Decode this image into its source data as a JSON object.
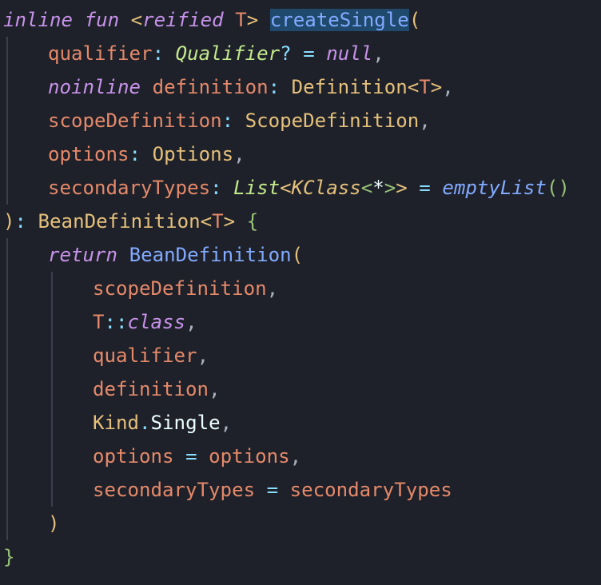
{
  "editor": {
    "lines": {
      "l1": {
        "inline": "inline",
        "fun": "fun",
        "lt": "<",
        "reified": "reified",
        "T": "T",
        "gt": ">",
        "name": "createSingle",
        "paren": "("
      },
      "l2": {
        "param": "qualifier",
        "colon": ":",
        "type": "Qualifier",
        "q": "?",
        "eq": "=",
        "null": "null",
        "comma": ","
      },
      "l3": {
        "noinline": "noinline",
        "param": "definition",
        "colon": ":",
        "type": "Definition",
        "lt": "<",
        "T": "T",
        "gt": ">",
        "comma": ","
      },
      "l4": {
        "param": "scopeDefinition",
        "colon": ":",
        "type": "ScopeDefinition",
        "comma": ","
      },
      "l5": {
        "param": "options",
        "colon": ":",
        "type": "Options",
        "comma": ","
      },
      "l6": {
        "param": "secondaryTypes",
        "colon": ":",
        "list": "List",
        "lt1": "<",
        "kclass": "KClass",
        "lt2": "<",
        "star": "*",
        "gt2": ">",
        "gt1": ">",
        "eq": "=",
        "fn": "emptyList",
        "parens": "()"
      },
      "l7": {
        "close": ")",
        "colon": ":",
        "type": "BeanDefinition",
        "lt": "<",
        "T": "T",
        "gt": ">",
        "brace": "{"
      },
      "l8": {
        "ret": "return",
        "fn": "BeanDefinition",
        "paren": "("
      },
      "l9": {
        "arg": "scopeDefinition",
        "comma": ","
      },
      "l10": {
        "T": "T",
        "cc": "::",
        "cls": "class",
        "comma": ","
      },
      "l11": {
        "arg": "qualifier",
        "comma": ","
      },
      "l12": {
        "arg": "definition",
        "comma": ","
      },
      "l13": {
        "kind": "Kind",
        "dot": ".",
        "single": "Single",
        "comma": ","
      },
      "l14": {
        "name": "options",
        "eq": "=",
        "val": "options",
        "comma": ","
      },
      "l15": {
        "name": "secondaryTypes",
        "eq": "=",
        "val": "secondaryTypes"
      },
      "l16": {
        "close": ")"
      },
      "l17": {
        "close": "}"
      }
    }
  }
}
